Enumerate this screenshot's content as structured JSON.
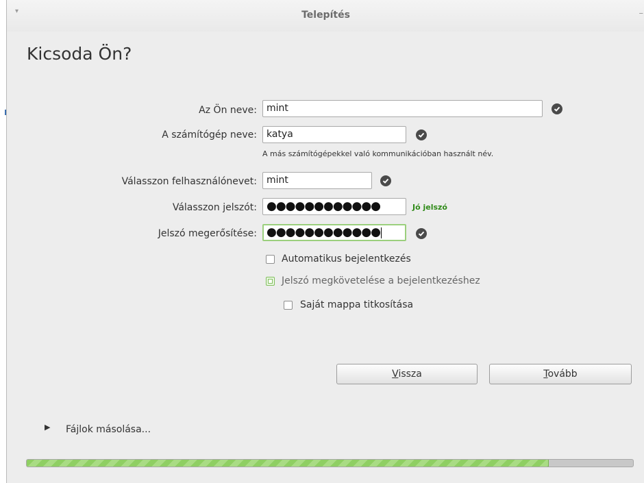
{
  "window": {
    "title": "Telepítés",
    "menu_glyph": "▾",
    "minimize_glyph": "–"
  },
  "page": {
    "heading": "Kicsoda Ön?"
  },
  "form": {
    "name": {
      "label": "Az Ön neve:",
      "value": "mint"
    },
    "computer": {
      "label": "A számítógép neve:",
      "value": "katya",
      "hint": "A más számítógépekkel való kommunikációban használt név."
    },
    "username": {
      "label": "Válasszon felhasználónevet:",
      "value": "mint"
    },
    "password": {
      "label": "Válasszon jelszót:",
      "value": "●●●●●●●●●●●●",
      "strength": "Jó jelszó"
    },
    "confirm": {
      "label": "Jelszó megerősítése:",
      "value": "●●●●●●●●●●●●"
    }
  },
  "options": {
    "autologin": {
      "label": "Automatikus bejelentkezés",
      "checked": false
    },
    "require_password": {
      "label": "Jelszó megkövetelése a bejelentkezéshez",
      "checked": true
    },
    "encrypt_home": {
      "label": "Saját mappa titkosítása",
      "checked": false
    }
  },
  "buttons": {
    "back": {
      "mnemonic": "V",
      "rest": "issza"
    },
    "forward": {
      "mnemonic": "T",
      "rest": "ovább"
    }
  },
  "footer": {
    "expander_glyph": "▶",
    "status": "Fájlok másolása...",
    "progress": 0.86
  },
  "colors": {
    "valid_icon": "#4a4a4a",
    "strength_text": "#2f8a18",
    "progress_fill": "#8fcf63"
  },
  "icons": {
    "valid": "check-circle-icon",
    "expander": "triangle-right-icon"
  }
}
